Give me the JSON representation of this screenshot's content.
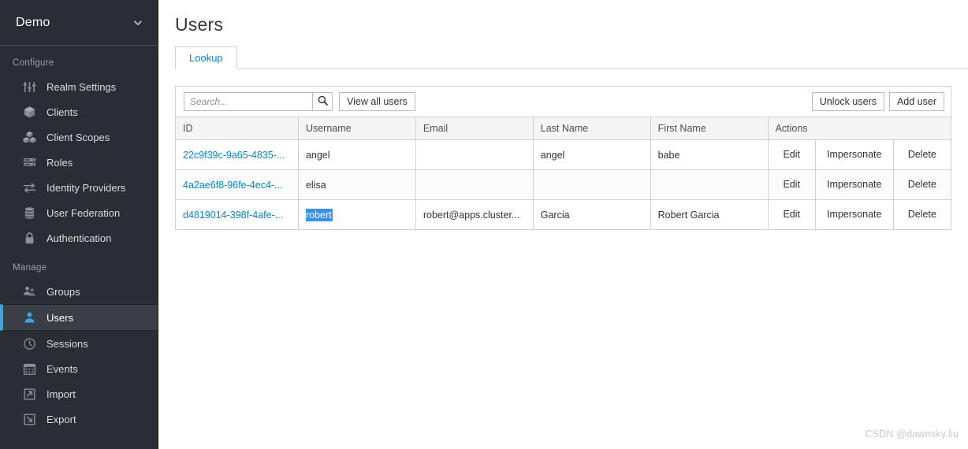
{
  "sidebar": {
    "realm": {
      "name": "Demo",
      "chevron_icon": "chevron-down-icon"
    },
    "sections": [
      {
        "title": "Configure",
        "items": [
          {
            "label": "Realm Settings",
            "icon": "sliders-icon",
            "active": false
          },
          {
            "label": "Clients",
            "icon": "cube-icon",
            "active": false
          },
          {
            "label": "Client Scopes",
            "icon": "cubes-icon",
            "active": false
          },
          {
            "label": "Roles",
            "icon": "list-rows-icon",
            "active": false
          },
          {
            "label": "Identity Providers",
            "icon": "exchange-arrows-icon",
            "active": false
          },
          {
            "label": "User Federation",
            "icon": "database-icon",
            "active": false
          },
          {
            "label": "Authentication",
            "icon": "lock-icon",
            "active": false
          }
        ]
      },
      {
        "title": "Manage",
        "items": [
          {
            "label": "Groups",
            "icon": "users-group-icon",
            "active": false
          },
          {
            "label": "Users",
            "icon": "user-icon",
            "active": true
          },
          {
            "label": "Sessions",
            "icon": "clock-icon",
            "active": false
          },
          {
            "label": "Events",
            "icon": "calendar-icon",
            "active": false
          },
          {
            "label": "Import",
            "icon": "import-arrow-icon",
            "active": false
          },
          {
            "label": "Export",
            "icon": "export-arrow-icon",
            "active": false
          }
        ]
      }
    ]
  },
  "main": {
    "page_title": "Users",
    "tabs": [
      {
        "label": "Lookup",
        "active": true
      }
    ],
    "toolbar": {
      "search_placeholder": "Search...",
      "search_value": "",
      "search_icon": "search-icon",
      "view_all_label": "View all users",
      "unlock_users_label": "Unlock users",
      "add_user_label": "Add user"
    },
    "table": {
      "columns": [
        "ID",
        "Username",
        "Email",
        "Last Name",
        "First Name",
        "Actions"
      ],
      "action_labels": [
        "Edit",
        "Impersonate",
        "Delete"
      ],
      "rows": [
        {
          "id": "22c9f39c-9a65-4835-...",
          "username": "angel",
          "username_selected": false,
          "email": "",
          "last_name": "angel",
          "first_name": "babe",
          "striped": false
        },
        {
          "id": "4a2ae6f8-96fe-4ec4-...",
          "username": "elisa",
          "username_selected": false,
          "email": "",
          "last_name": "",
          "first_name": "",
          "striped": true
        },
        {
          "id": "d4819014-398f-4afe-...",
          "username": "robert",
          "username_selected": true,
          "email": "robert@apps.cluster...",
          "last_name": "Garcia",
          "first_name": "Robert Garcia",
          "striped": false
        }
      ]
    }
  },
  "watermark": "CSDN @dawnsky.liu",
  "colors": {
    "sidebar_bg": "#292e34",
    "sidebar_active_bg": "#393f44",
    "accent_blue": "#0088ce",
    "active_marker": "#39a5dc",
    "selection_blue": "#3390ff",
    "border_gray": "#d1d1d1",
    "header_bg": "#f5f5f5"
  }
}
